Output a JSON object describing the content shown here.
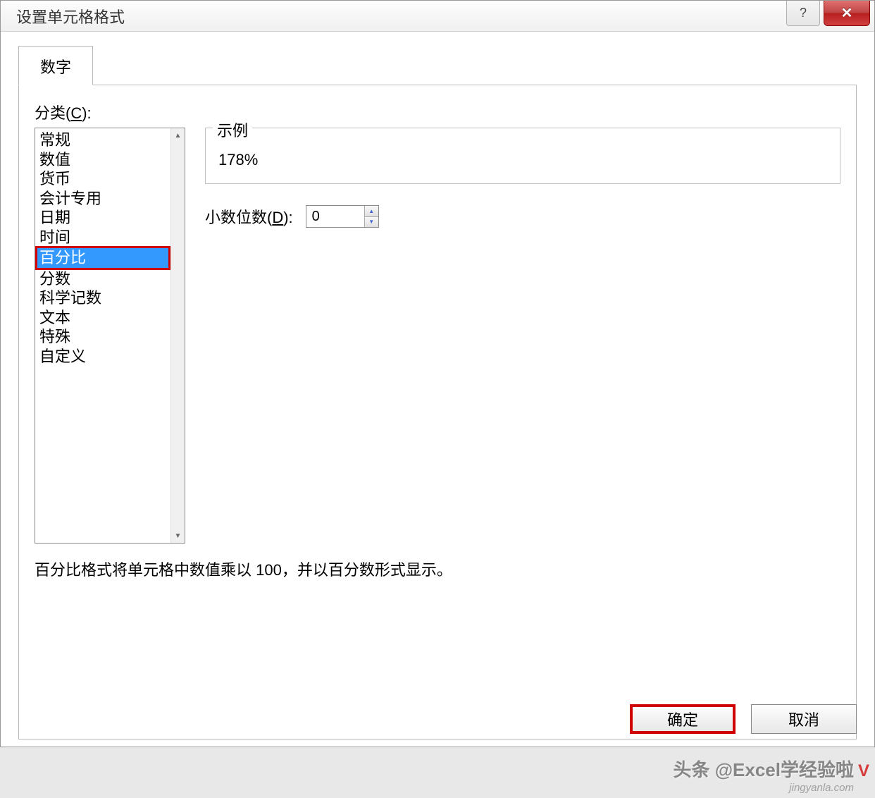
{
  "window": {
    "title": "设置单元格格式"
  },
  "titlebar": {
    "help_label": "?",
    "close_label": "✕"
  },
  "tabs": {
    "number": "数字"
  },
  "category": {
    "label_prefix": "分类(",
    "label_key": "C",
    "label_suffix": "):",
    "items": [
      "常规",
      "数值",
      "货币",
      "会计专用",
      "日期",
      "时间",
      "百分比",
      "分数",
      "科学记数",
      "文本",
      "特殊",
      "自定义"
    ],
    "selected_index": 6
  },
  "example": {
    "legend": "示例",
    "value": "178%"
  },
  "decimal": {
    "label_prefix": "小数位数(",
    "label_key": "D",
    "label_suffix": "):",
    "value": "0"
  },
  "description": "百分比格式将单元格中数值乘以 100，并以百分数形式显示。",
  "buttons": {
    "ok": "确定",
    "cancel": "取消"
  },
  "watermark": {
    "text": "头条 @Excel学经验啦",
    "url": "jingyanla.com",
    "badge": "V"
  }
}
